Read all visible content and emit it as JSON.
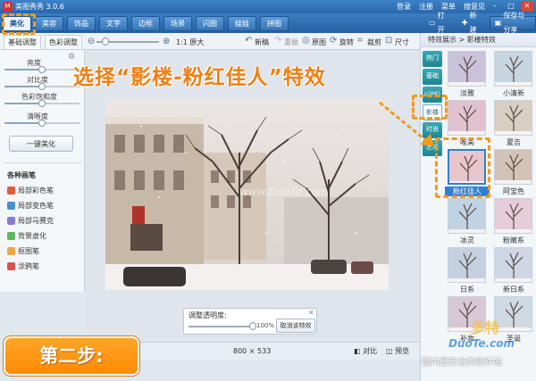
{
  "window": {
    "title": "美图秀秀 3.0.6",
    "app_icon": "M"
  },
  "top_links": [
    "登录",
    "注册",
    "菜单",
    "搜意见"
  ],
  "window_controls": {
    "minimize": "–",
    "maximize": "□",
    "close": "✕"
  },
  "nav_tabs": [
    {
      "label": "美化",
      "active": true
    },
    {
      "label": "美容"
    },
    {
      "label": "饰品"
    },
    {
      "label": "文字"
    },
    {
      "label": "边框"
    },
    {
      "label": "场景"
    },
    {
      "label": "闪图"
    },
    {
      "label": "娃娃"
    },
    {
      "label": "拼图"
    }
  ],
  "nav_actions": {
    "open": "打开",
    "new": "新建",
    "save": "保存与分享"
  },
  "left_tabs": {
    "basic": "基础调整",
    "color": "色彩调整"
  },
  "toolbar": {
    "zoom_label": "1:1 原大",
    "zoom_level": 0.1,
    "tools": [
      "新稿",
      "重做",
      "原图",
      "旋转",
      "裁剪",
      "尺寸"
    ]
  },
  "adjustments": [
    {
      "label": "亮度",
      "value": 0.5
    },
    {
      "label": "对比度",
      "value": 0.5
    },
    {
      "label": "色彩饱和度",
      "value": 0.5
    },
    {
      "label": "清晰度",
      "value": 0.5
    }
  ],
  "one_click": "一键美化",
  "brushes_title": "各种画笔",
  "brushes": [
    {
      "label": "局部彩色笔",
      "color": "#e05b3c"
    },
    {
      "label": "局部变色笔",
      "color": "#4a8fd0"
    },
    {
      "label": "局部马赛克",
      "color": "#8a7bd2"
    },
    {
      "label": "背景虚化",
      "color": "#5cb85c"
    },
    {
      "label": "抠图笔",
      "color": "#f0a640"
    },
    {
      "label": "涂鸦笔",
      "color": "#d9534f"
    }
  ],
  "photo": {
    "watermark": "www.DuoTe.com"
  },
  "transparency": {
    "label": "调整透明度:",
    "value_text": "100%",
    "value": 1.0,
    "cancel": "取消该特效"
  },
  "status_bar": {
    "size": "800 × 533",
    "compare": "对比",
    "preview": "预览"
  },
  "right_panel": {
    "header": "特效展示 > 影楼特效",
    "side_tabs": [
      "热门",
      "基础",
      "LOMO",
      "影楼",
      "时尚",
      "艺术"
    ],
    "active_side_tab": "影楼",
    "effects": [
      "淡雅",
      "小清新",
      "唯美",
      "夏吉",
      "粉红佳人",
      "阿宝色",
      "冰灵",
      "粉嫩系",
      "日系",
      "新日系",
      "补妆",
      "圣诞"
    ],
    "selected_effect": "粉红佳人"
  },
  "overlay": {
    "title": "选择“影楼-粉红佳人”特效",
    "step": "第二步:"
  },
  "site_watermark": {
    "brand": "多特",
    "url": "DuoTe.com",
    "slogan": "国内最安全的软件站"
  },
  "accent_color": "#f29a1c"
}
